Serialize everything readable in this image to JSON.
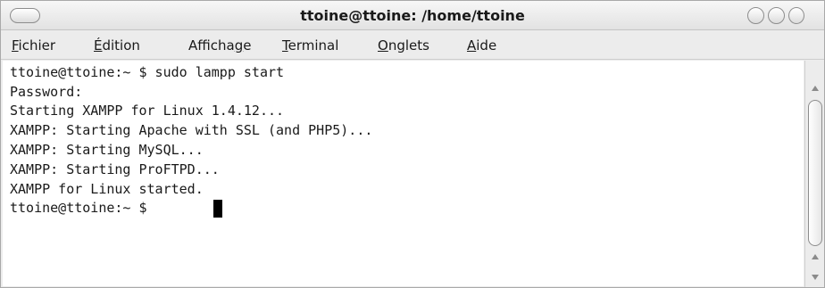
{
  "window": {
    "title": "ttoine@ttoine: /home/ttoine"
  },
  "menubar": {
    "items": [
      {
        "mnemonic": "F",
        "rest": "ichier"
      },
      {
        "mnemonic": "É",
        "rest": "dition"
      },
      {
        "pre": "Afficha",
        "mnemonic": "g",
        "rest": "e"
      },
      {
        "mnemonic": "T",
        "rest": "erminal"
      },
      {
        "mnemonic": "O",
        "rest": "nglets"
      },
      {
        "mnemonic": "A",
        "rest": "ide"
      }
    ]
  },
  "terminal": {
    "lines": [
      "ttoine@ttoine:~ $ sudo lampp start",
      "Password:",
      "Starting XAMPP for Linux 1.4.12...",
      "XAMPP: Starting Apache with SSL (and PHP5)...",
      "XAMPP: Starting MySQL...",
      "XAMPP: Starting ProFTPD...",
      "XAMPP for Linux started.",
      "ttoine@ttoine:~ $ "
    ]
  },
  "colors": {
    "terminal_bg": "#ffffff",
    "terminal_fg": "#1a1a1a",
    "chrome_bg": "#ececec"
  }
}
